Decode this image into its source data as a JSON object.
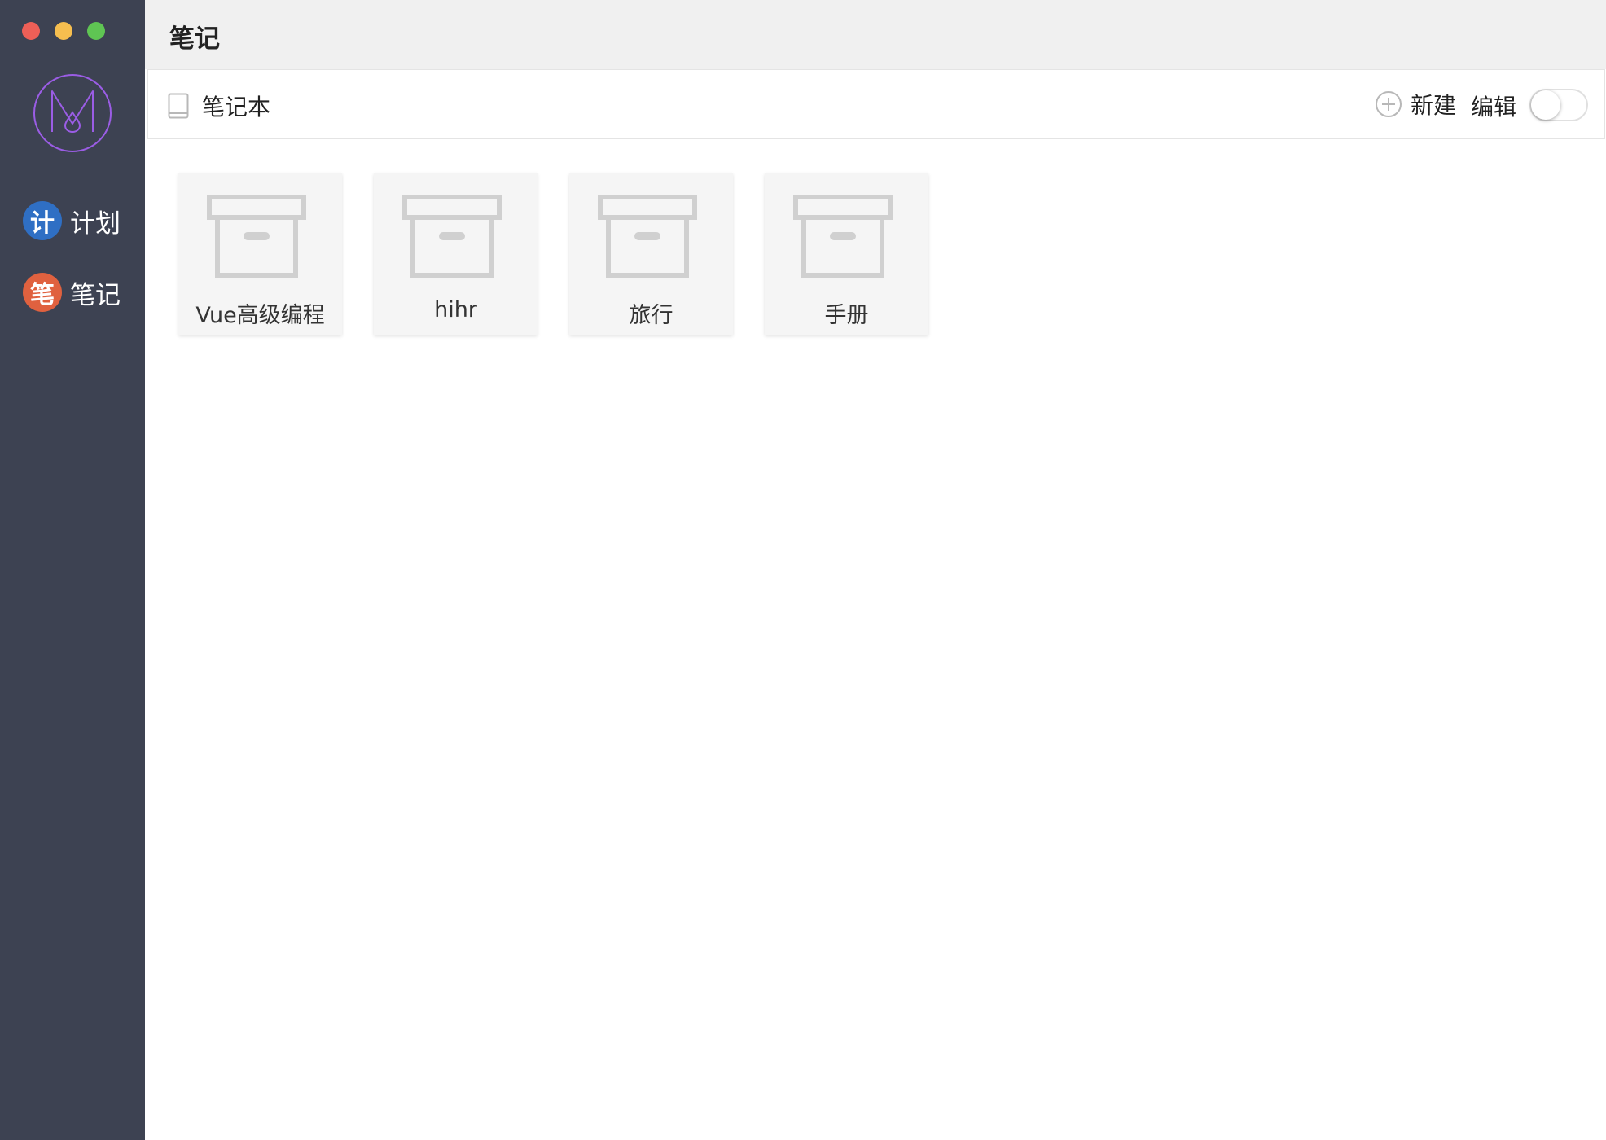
{
  "window": {
    "title": "笔记"
  },
  "sidebar": {
    "logo": "m-logo-icon",
    "items": [
      {
        "badge": "计",
        "label": "计划",
        "badge_color": "#2f6fc4"
      },
      {
        "badge": "笔",
        "label": "笔记",
        "badge_color": "#e0613f"
      }
    ]
  },
  "toolbar": {
    "section_icon": "book-icon",
    "section_label": "笔记本",
    "new_label": "新建",
    "edit_label": "编辑",
    "edit_enabled": false
  },
  "notebooks": [
    {
      "name": "Vue高级编程",
      "icon": "archive-box-icon"
    },
    {
      "name": "hihr",
      "icon": "archive-box-icon"
    },
    {
      "name": "旅行",
      "icon": "archive-box-icon"
    },
    {
      "name": "手册",
      "icon": "archive-box-icon"
    }
  ],
  "colors": {
    "sidebar_bg": "#3d4252",
    "accent_purple": "#9b5de5",
    "card_bg": "#f5f5f5",
    "icon_gray": "#d0d0d0"
  }
}
